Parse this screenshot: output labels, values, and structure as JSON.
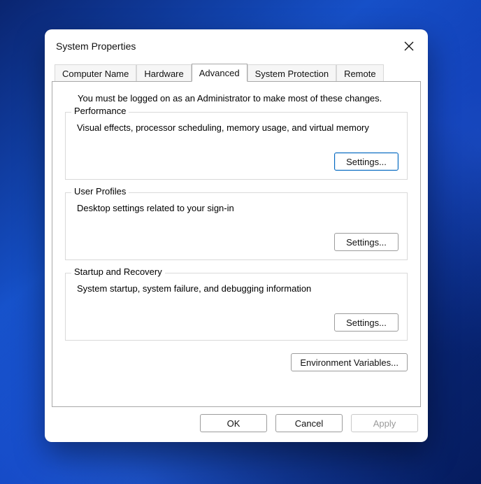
{
  "window": {
    "title": "System Properties"
  },
  "tabs": {
    "computer_name": "Computer Name",
    "hardware": "Hardware",
    "advanced": "Advanced",
    "system_protection": "System Protection",
    "remote": "Remote"
  },
  "advanced": {
    "intro": "You must be logged on as an Administrator to make most of these changes.",
    "performance": {
      "legend": "Performance",
      "desc": "Visual effects, processor scheduling, memory usage, and virtual memory",
      "button": "Settings..."
    },
    "user_profiles": {
      "legend": "User Profiles",
      "desc": "Desktop settings related to your sign-in",
      "button": "Settings..."
    },
    "startup_recovery": {
      "legend": "Startup and Recovery",
      "desc": "System startup, system failure, and debugging information",
      "button": "Settings..."
    },
    "env_vars_button": "Environment Variables..."
  },
  "footer": {
    "ok": "OK",
    "cancel": "Cancel",
    "apply": "Apply"
  }
}
